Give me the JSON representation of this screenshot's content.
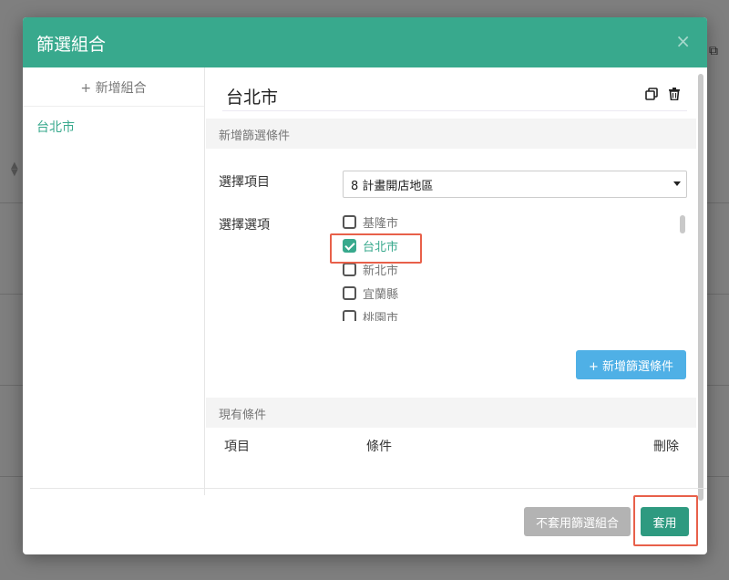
{
  "modal": {
    "title": "篩選組合",
    "close_glyph": "×"
  },
  "sidebar": {
    "add_group_label": "+ 新增組合",
    "groups": [
      {
        "label": "台北市"
      }
    ]
  },
  "editor": {
    "group_name": "台北市",
    "add_section_title": "新增篩選條件",
    "select_item_label": "選擇項目",
    "select_item_value": "8 計畫開店地區",
    "select_option_label": "選擇選項",
    "options": [
      {
        "label": "基隆市",
        "checked": false
      },
      {
        "label": "台北市",
        "checked": true
      },
      {
        "label": "新北市",
        "checked": false
      },
      {
        "label": "宜蘭縣",
        "checked": false
      },
      {
        "label": "桃園市",
        "checked": false
      }
    ],
    "add_condition_label": "+ 新增篩選條件",
    "existing_section_title": "現有條件",
    "columns": {
      "item": "項目",
      "condition": "條件",
      "delete": "刪除"
    }
  },
  "footer": {
    "no_apply_label": "不套用篩選組合",
    "apply_label": "套用"
  },
  "icons": {
    "copy": "copy-icon",
    "delete": "trash-icon",
    "external": "external-link-icon",
    "sort": "sort-icon"
  },
  "colors": {
    "header": "#38a98d",
    "accent": "#38a98d",
    "info_button": "#4fb0e6",
    "apply_button": "#2e9a80",
    "highlight": "#e8604a"
  }
}
